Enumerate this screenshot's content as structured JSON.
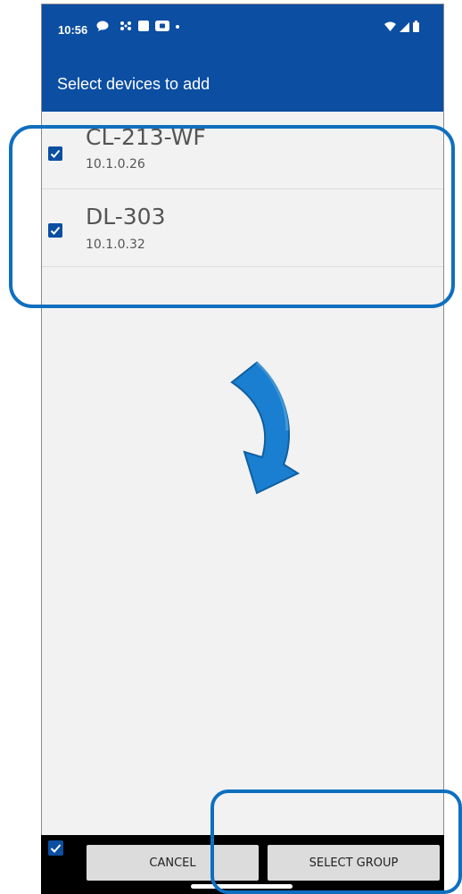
{
  "status_bar": {
    "time": "10:56"
  },
  "header": {
    "title": "Select devices to add"
  },
  "devices": [
    {
      "name": "CL-213-WF",
      "ip": "10.1.0.26",
      "checked": true
    },
    {
      "name": "DL-303",
      "ip": "10.1.0.32",
      "checked": true
    }
  ],
  "footer": {
    "cancel_label": "CANCEL",
    "select_group_label": "SELECT GROUP",
    "select_all_checked": true
  },
  "colors": {
    "primary": "#0b4ea2",
    "highlight": "#0f6fbf",
    "background": "#f2f2f2"
  },
  "annotations": {
    "arrow_icon": "curved-down-arrow-icon"
  }
}
